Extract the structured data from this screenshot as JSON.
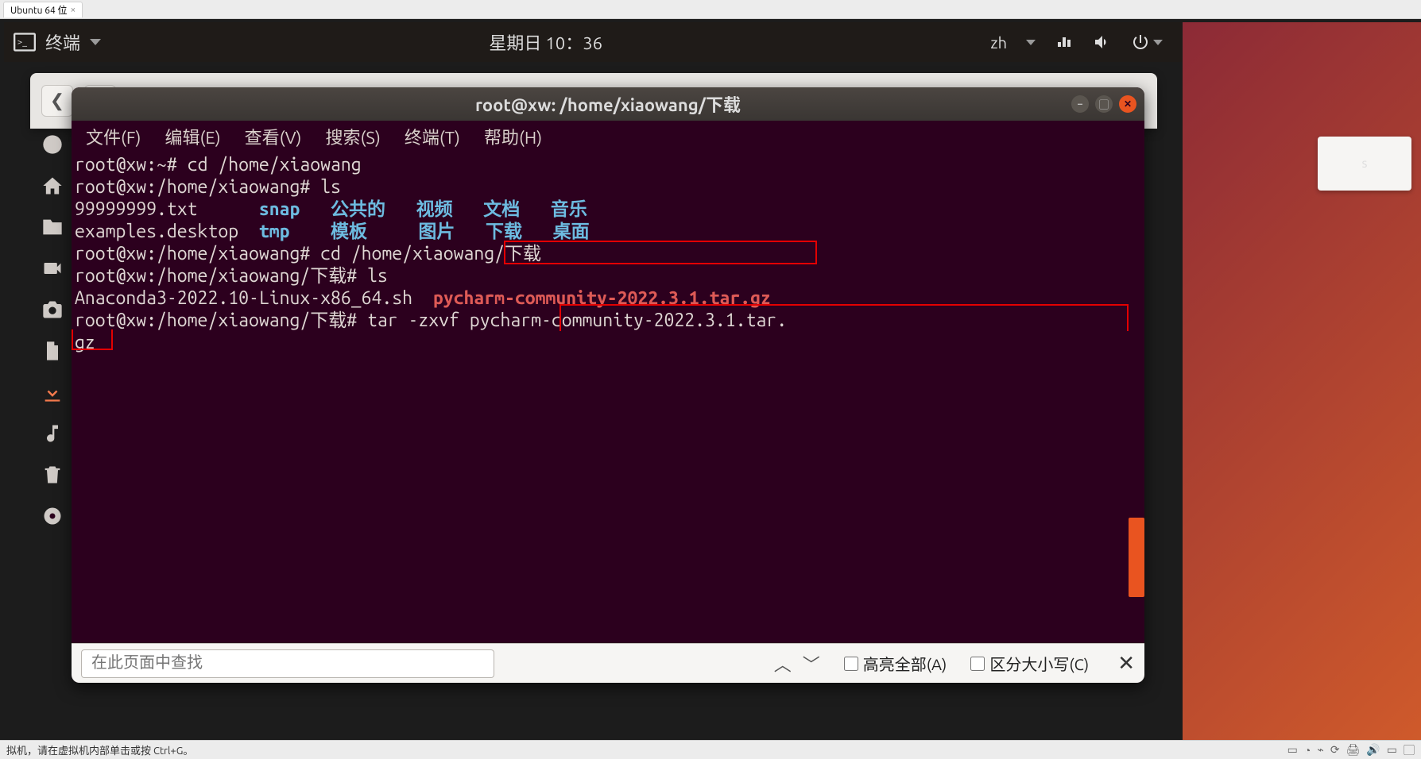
{
  "host": {
    "tab_label": "Ubuntu 64 位",
    "status_text": "拟机，请在虚拟机内部单击或按 Ctrl+G。"
  },
  "panel": {
    "app_label": "终端",
    "clock": "星期日 10：36",
    "input_method": "zh"
  },
  "folderTab": {
    "label": "s"
  },
  "terminal": {
    "title": "root@xw: /home/xiaowang/下载",
    "menu": {
      "file": "文件(F)",
      "edit": "编辑(E)",
      "view": "查看(V)",
      "search": "搜索(S)",
      "terminal": "终端(T)",
      "help": "帮助(H)"
    },
    "lines": {
      "l1_prompt": "root@xw:~#",
      "l1_cmd": " cd /home/xiaowang",
      "l2_prompt": "root@xw:/home/xiaowang#",
      "l2_cmd": " ls",
      "l3a": "99999999.txt      ",
      "l3b": "snap",
      "l3c": "   公共的   视频   文档   音乐",
      "l4a": "examples.desktop  ",
      "l4b": "tmp",
      "l4c": "    模板     图片   下载   桌面",
      "l5_prompt": "root@xw:/home/xiaowang#",
      "l5_cmd": " cd /home/xiaowang/下载",
      "l6_prompt": "root@xw:/home/xiaowang/下载#",
      "l6_cmd": " ls",
      "l7a": "Anaconda3-2022.10-Linux-x86_64.sh  ",
      "l7b": "pycharm-community-2022.3.1.tar.gz",
      "l8_prompt": "root@xw:/home/xiaowang/下载#",
      "l8_cmd": " tar -zxvf pycharm-community-2022.3.1.tar.",
      "l9": "gz"
    },
    "findbar": {
      "placeholder": "在此页面中查找",
      "highlight_all": "高亮全部(A)",
      "match_case": "区分大小写(C)"
    }
  }
}
